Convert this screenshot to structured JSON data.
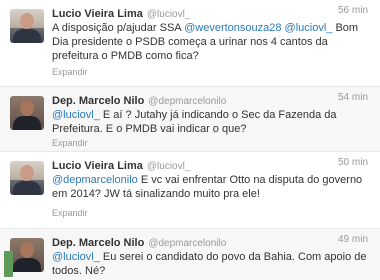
{
  "tweets": [
    {
      "name": "Lucio Vieira Lima",
      "handle": "@luciovl_",
      "time": "56 min",
      "text_parts": [
        {
          "t": "A disposição p/ajudar SSA ",
          "m": false
        },
        {
          "t": "@wevertonsouza28",
          "m": true
        },
        {
          "t": " ",
          "m": false
        },
        {
          "t": "@luciovl_",
          "m": true
        },
        {
          "t": " Bom Dia presidente o PSDB começa a urinar nos 4 cantos da prefeitura o PMDB como fica?",
          "m": false
        }
      ],
      "expand": "Expandir"
    },
    {
      "name": "Dep. Marcelo Nilo",
      "handle": "@depmarcelonilo",
      "time": "54 min",
      "text_parts": [
        {
          "t": "@luciovl_",
          "m": true
        },
        {
          "t": " E aí ? Jutahy já indicando o Sec da Fazenda da Prefeitura. E o PMDB vai indicar o que?",
          "m": false
        }
      ],
      "expand": "Expandir"
    },
    {
      "name": "Lucio Vieira Lima",
      "handle": "@luciovl_",
      "time": "50 min",
      "text_parts": [
        {
          "t": "@depmarcelonilo",
          "m": true
        },
        {
          "t": " E vc vai enfrentar Otto na disputa do governo em 2014? JW tá sinalizando muito pra ele!",
          "m": false
        }
      ],
      "expand": "Expandir"
    },
    {
      "name": "Dep. Marcelo Nilo",
      "handle": "@depmarcelonilo",
      "time": "49 min",
      "text_parts": [
        {
          "t": "@luciovl_",
          "m": true
        },
        {
          "t": " Eu serei o candidato do povo da Bahia. Com apoio de todos. Né?",
          "m": false
        }
      ],
      "expand": ""
    }
  ],
  "colors": {
    "mention": "#2b7bb9",
    "text": "#333333",
    "muted": "#999999"
  }
}
